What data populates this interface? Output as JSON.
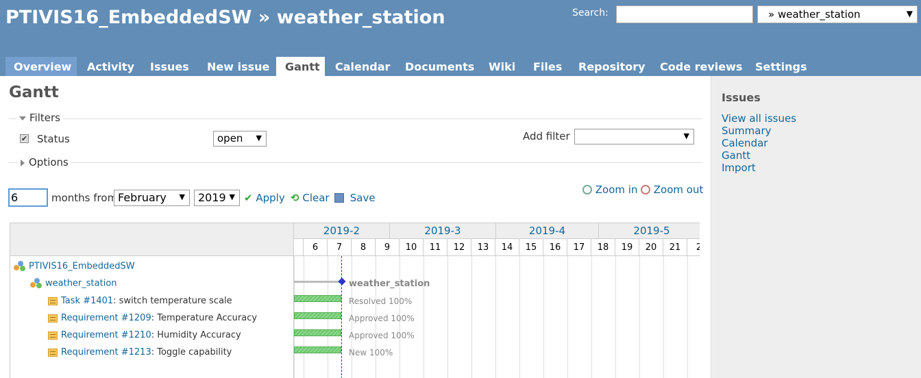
{
  "header": {
    "project_title": "PTIVIS16_EmbeddedSW » weather_station",
    "search_label": "Search:",
    "search_value": "",
    "project_jump": "» weather_station"
  },
  "main_menu": [
    {
      "label": "Overview"
    },
    {
      "label": "Activity"
    },
    {
      "label": "Issues"
    },
    {
      "label": "New issue"
    },
    {
      "label": "Gantt",
      "selected": true
    },
    {
      "label": "Calendar"
    },
    {
      "label": "Documents"
    },
    {
      "label": "Wiki"
    },
    {
      "label": "Files"
    },
    {
      "label": "Repository"
    },
    {
      "label": "Code reviews"
    },
    {
      "label": "Settings"
    }
  ],
  "page_title": "Gantt",
  "filters": {
    "legend": "Filters",
    "status_label": "Status",
    "status_checked": true,
    "status_operator": "open",
    "add_filter_label": "Add filter",
    "add_filter_value": ""
  },
  "options": {
    "legend": "Options"
  },
  "toolbar": {
    "months": "6",
    "months_from_label": "months from",
    "month": "February",
    "year": "2019",
    "apply": "Apply",
    "clear": "Clear",
    "save": "Save",
    "zoom_in": "Zoom in",
    "zoom_out": "Zoom out"
  },
  "gantt": {
    "months": [
      "2019-2",
      "2019-3",
      "2019-4",
      "2019-5"
    ],
    "weeks": [
      "6",
      "7",
      "8",
      "9",
      "10",
      "11",
      "12",
      "13",
      "14",
      "15",
      "16",
      "17",
      "18",
      "19",
      "20",
      "21",
      "2"
    ],
    "rows": [
      {
        "type": "project",
        "name": "PTIVIS16_EmbeddedSW"
      },
      {
        "type": "version",
        "name": "weather_station",
        "bar_label": "weather_station"
      },
      {
        "type": "issue",
        "link": "Task #1401",
        "subject": ": switch temperature scale",
        "status": "Resolved 100%"
      },
      {
        "type": "issue",
        "link": "Requirement #1209",
        "subject": ": Temperature Accuracy",
        "status": "Approved 100%"
      },
      {
        "type": "issue",
        "link": "Requirement #1210",
        "subject": ": Humidity Accuracy",
        "status": "Approved 100%"
      },
      {
        "type": "issue",
        "link": "Requirement #1213",
        "subject": ": Toggle capability",
        "status": "New 100%"
      }
    ]
  },
  "sidebar": {
    "title": "Issues",
    "links": [
      "View all issues",
      "Summary",
      "Calendar",
      "Gantt",
      "Import"
    ]
  },
  "colors": {
    "header_bg": "#628db6",
    "link": "#116699",
    "bar_green": "#8fd88f",
    "today_line": "#cc0000"
  }
}
